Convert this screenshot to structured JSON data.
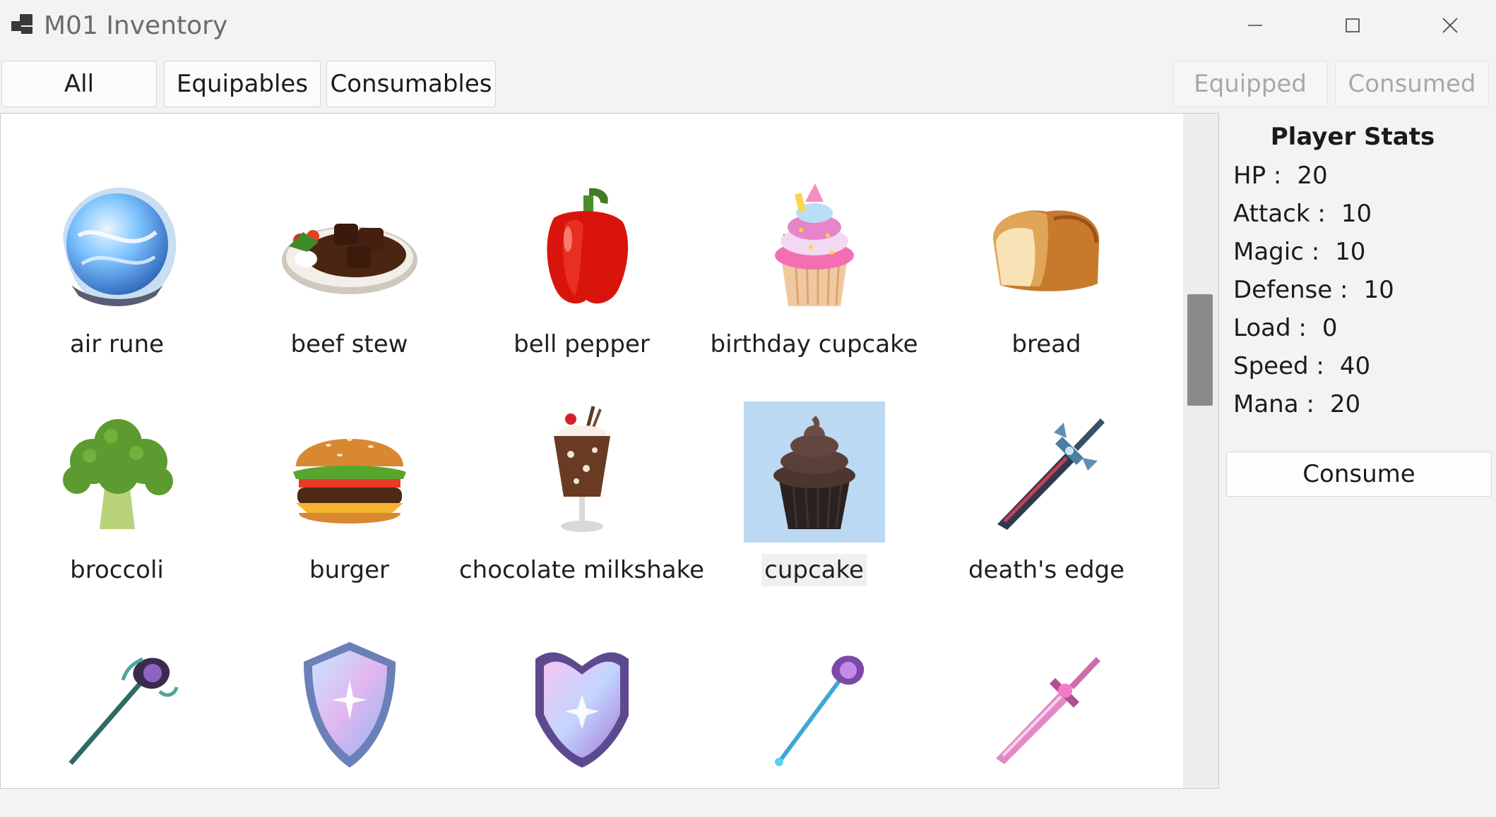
{
  "window": {
    "title": "M01 Inventory",
    "controls": [
      "minimize-icon",
      "maximize-icon",
      "close-icon"
    ]
  },
  "filters": {
    "all": "All",
    "equipables": "Equipables",
    "consumables": "Consumables",
    "equipped": "Equipped",
    "consumed": "Consumed"
  },
  "items": [
    {
      "name": "air rune",
      "icon": "air-rune-icon"
    },
    {
      "name": "beef stew",
      "icon": "beef-stew-icon"
    },
    {
      "name": "bell pepper",
      "icon": "bell-pepper-icon"
    },
    {
      "name": "birthday cupcake",
      "icon": "birthday-cupcake-icon"
    },
    {
      "name": "bread",
      "icon": "bread-icon"
    },
    {
      "name": "broccoli",
      "icon": "broccoli-icon"
    },
    {
      "name": "burger",
      "icon": "burger-icon"
    },
    {
      "name": "chocolate milkshake",
      "icon": "chocolate-milkshake-icon"
    },
    {
      "name": "cupcake",
      "icon": "cupcake-icon",
      "selected": true
    },
    {
      "name": "death's edge",
      "icon": "sword-icon"
    },
    {
      "name": "",
      "icon": "staff-icon"
    },
    {
      "name": "",
      "icon": "shield-icon"
    },
    {
      "name": "",
      "icon": "armor-icon"
    },
    {
      "name": "",
      "icon": "wand-icon"
    },
    {
      "name": "",
      "icon": "pink-sword-icon"
    }
  ],
  "stats": {
    "title": "Player Stats",
    "hp_label": "HP :",
    "hp": "20",
    "attack_label": "Attack :",
    "attack": "10",
    "magic_label": "Magic :",
    "magic": "10",
    "defense_label": "Defense :",
    "defense": "10",
    "load_label": "Load :",
    "load": "0",
    "speed_label": "Speed :",
    "speed": "40",
    "mana_label": "Mana :",
    "mana": "20"
  },
  "actions": {
    "consume": "Consume"
  },
  "colors": {
    "selection": "#bcd9f3",
    "background": "#f3f3f3",
    "panel": "#ffffff"
  }
}
